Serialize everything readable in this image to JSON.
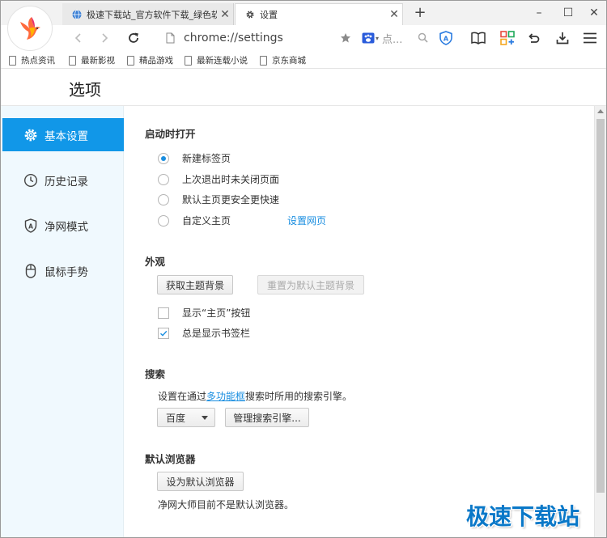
{
  "tabs": [
    {
      "title": "极速下载站_官方软件下载_绿色软",
      "icon": "globe-icon",
      "active": false
    },
    {
      "title": "设置",
      "icon": "gear-icon",
      "active": true
    }
  ],
  "new_tab_symbol": "+",
  "window_controls": {
    "close_tab_symbol": "✕",
    "minimize": "–",
    "maximize": "☐",
    "close": "✕"
  },
  "toolbar": {
    "url": "chrome://settings",
    "search_placeholder": "点...",
    "icons": [
      "back-icon",
      "forward-icon",
      "reload-icon",
      "page-icon",
      "star-icon",
      "search-engine-icon",
      "search-icon",
      "shield-icon",
      "reader-icon",
      "apps-icon",
      "undo-icon",
      "download-icon",
      "menu-icon"
    ]
  },
  "bookmarks": [
    "热点资讯",
    "最新影视",
    "精品游戏",
    "最新连载小说",
    "京东商城"
  ],
  "page": {
    "title": "选项"
  },
  "sidebar": {
    "items": [
      {
        "label": "基本设置",
        "icon": "gear-icon",
        "active": true
      },
      {
        "label": "历史记录",
        "icon": "clock-icon",
        "active": false
      },
      {
        "label": "净网模式",
        "icon": "shield-icon",
        "active": false
      },
      {
        "label": "鼠标手势",
        "icon": "mouse-icon",
        "active": false
      }
    ]
  },
  "startup": {
    "title": "启动时打开",
    "options": [
      "新建标签页",
      "上次退出时未关闭页面",
      "默认主页更安全更快速",
      "自定义主页"
    ],
    "selected_index": 0,
    "set_pages_link": "设置网页"
  },
  "appearance": {
    "title": "外观",
    "get_theme_button": "获取主题背景",
    "reset_theme_button": "重置为默认主题背景",
    "show_home_button": {
      "label": "显示“主页”按钮",
      "checked": false
    },
    "show_bookmarks_bar": {
      "label": "总是显示书签栏",
      "checked": true
    }
  },
  "search": {
    "title": "搜索",
    "desc_before": "设置在通过",
    "desc_link": "多功能框",
    "desc_after": "搜索时所用的搜索引擎。",
    "engine": "百度",
    "manage_button": "管理搜索引擎..."
  },
  "default_browser": {
    "title": "默认浏览器",
    "set_button": "设为默认浏览器",
    "status": "净网大师目前不是默认浏览器。"
  },
  "watermark": "极速下载站",
  "colors": {
    "accent": "#1197e8",
    "link": "#1a8ee0",
    "sidebar_bg": "#f0f9fe"
  }
}
